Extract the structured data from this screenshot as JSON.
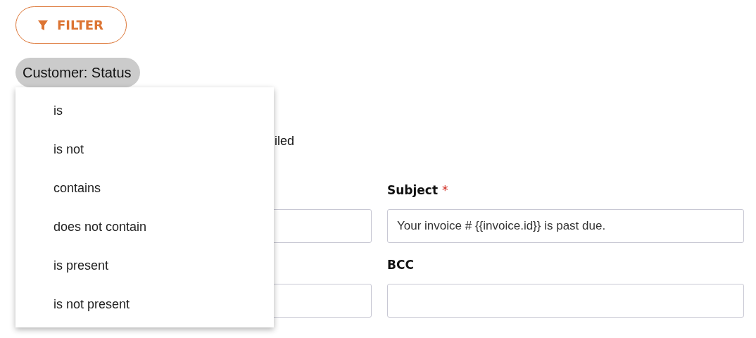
{
  "filter_button": {
    "label": "FILTER"
  },
  "filter_chip": {
    "label": "Customer: Status"
  },
  "status_text": "iled",
  "fields": [
    {
      "label": "Subject",
      "required_mark": "*",
      "value": "Your invoice # {{invoice.id}} is past due."
    },
    {
      "label": "BCC"
    }
  ],
  "operator_menu": {
    "items": [
      {
        "label": "is"
      },
      {
        "label": "is not"
      },
      {
        "label": "contains"
      },
      {
        "label": "does not contain"
      },
      {
        "label": "is present"
      },
      {
        "label": "is not present"
      }
    ]
  }
}
